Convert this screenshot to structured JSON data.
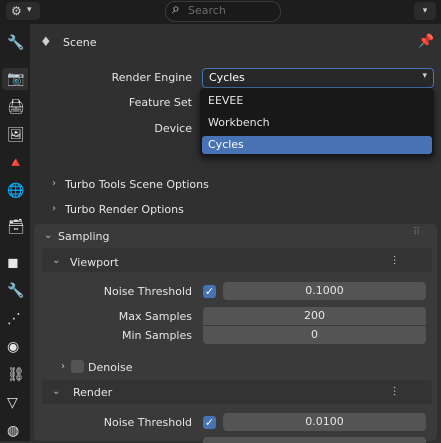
{
  "header": {
    "search_placeholder": "Search",
    "editor_icon": "properties-editor-icon",
    "editor_dropdown": "▾",
    "options_dropdown": "▾"
  },
  "sidebar": {
    "tabs": [
      {
        "icon": "tool-icon",
        "glyph": "🔧"
      },
      {
        "icon": "render-icon",
        "glyph": "📷"
      },
      {
        "icon": "output-icon",
        "glyph": "🖨"
      },
      {
        "icon": "view-layer-icon",
        "glyph": "🖼"
      },
      {
        "icon": "scene-icon",
        "glyph": "🔺"
      },
      {
        "icon": "world-icon",
        "glyph": "🌐"
      },
      {
        "icon": "collection-icon",
        "glyph": "🗃"
      },
      {
        "icon": "object-icon",
        "glyph": "◼"
      },
      {
        "icon": "modifier-icon",
        "glyph": "🔧"
      },
      {
        "icon": "particles-icon",
        "glyph": "⋰"
      },
      {
        "icon": "physics-icon",
        "glyph": "◉"
      },
      {
        "icon": "constraints-icon",
        "glyph": "⛓"
      },
      {
        "icon": "data-icon",
        "glyph": "▽"
      },
      {
        "icon": "material-icon",
        "glyph": "◍"
      }
    ],
    "active_index": 1
  },
  "breadcrumb": {
    "icon": "scene-icon",
    "label": "Scene",
    "pin_icon": "pin-icon"
  },
  "render_engine": {
    "label": "Render Engine",
    "value": "Cycles",
    "options": [
      "EEVEE",
      "Workbench",
      "Cycles"
    ],
    "selected_index": 2
  },
  "feature_set": {
    "label": "Feature Set"
  },
  "device": {
    "label": "Device"
  },
  "panels": {
    "turbo_tools": "Turbo Tools Scene Options",
    "turbo_render": "Turbo Render Options",
    "sampling": "Sampling"
  },
  "viewport": {
    "title": "Viewport",
    "noise_threshold_label": "Noise Threshold",
    "noise_threshold_value": "0.1000",
    "noise_threshold_enabled": true,
    "max_samples_label": "Max Samples",
    "max_samples_value": "200",
    "min_samples_label": "Min Samples",
    "min_samples_value": "0",
    "denoise_label": "Denoise"
  },
  "render": {
    "title": "Render",
    "noise_threshold_label": "Noise Threshold",
    "noise_threshold_value": "0.0100",
    "noise_threshold_enabled": true
  },
  "colors": {
    "accent": "#4772b3",
    "bg": "#303030",
    "panel": "#3a3a3a",
    "field": "#545454"
  }
}
